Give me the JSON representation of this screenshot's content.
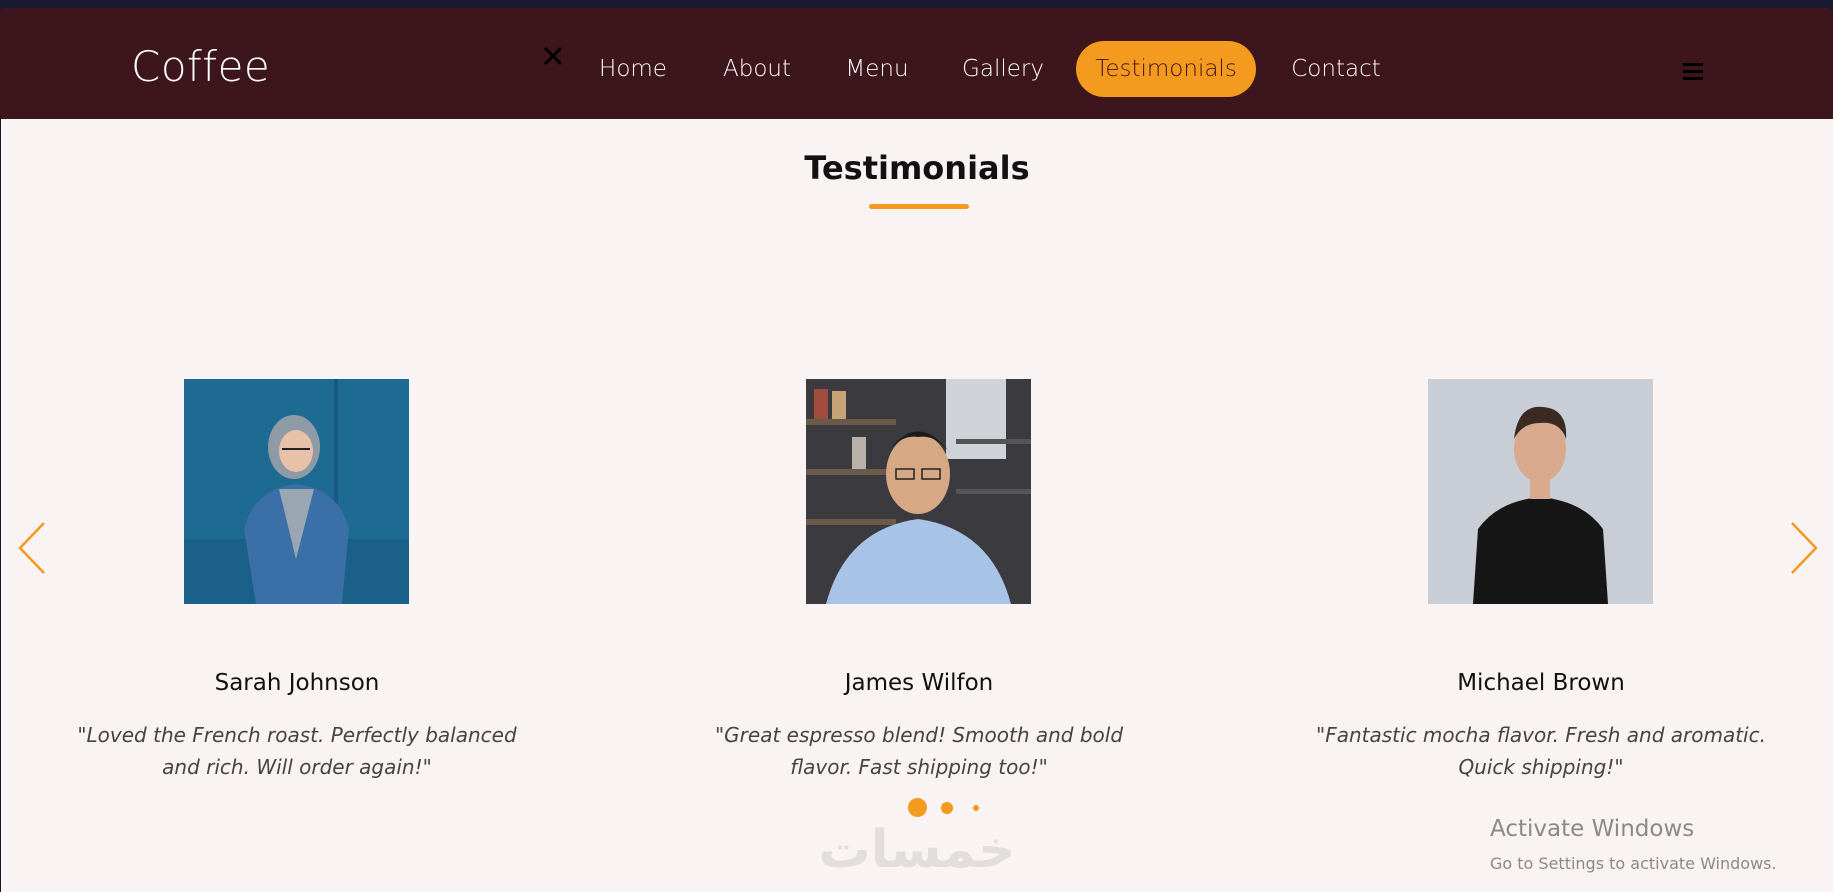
{
  "brand": {
    "logo_text": "Coffee"
  },
  "nav": {
    "items": [
      {
        "label": "Home"
      },
      {
        "label": "About"
      },
      {
        "label": "Menu"
      },
      {
        "label": "Gallery"
      },
      {
        "label": "Testimonials",
        "active": true
      },
      {
        "label": "Contact"
      }
    ],
    "close_icon": "close-icon",
    "menu_icon": "hamburger-icon"
  },
  "colors": {
    "navbar_bg": "#3d151d",
    "accent": "#f39a1f",
    "page_bg": "#f9f3f3"
  },
  "section": {
    "title": "Testimonials"
  },
  "carousel": {
    "prev_icon": "chevron-left-icon",
    "next_icon": "chevron-right-icon",
    "dots": 3,
    "active_dot": 0
  },
  "testimonials": [
    {
      "name": "Sarah Johnson",
      "quote": "\"Loved the French roast. Perfectly balanced and rich. Will order again!\""
    },
    {
      "name": "James Wilfon",
      "quote": "\"Great espresso blend! Smooth and bold flavor. Fast shipping too!\""
    },
    {
      "name": "Michael Brown",
      "quote": "\"Fantastic mocha flavor. Fresh and aromatic. Quick shipping!\""
    }
  ],
  "watermark": {
    "text": "خمسات"
  },
  "windows_notice": {
    "title": "Activate Windows",
    "subtitle": "Go to Settings to activate Windows."
  }
}
